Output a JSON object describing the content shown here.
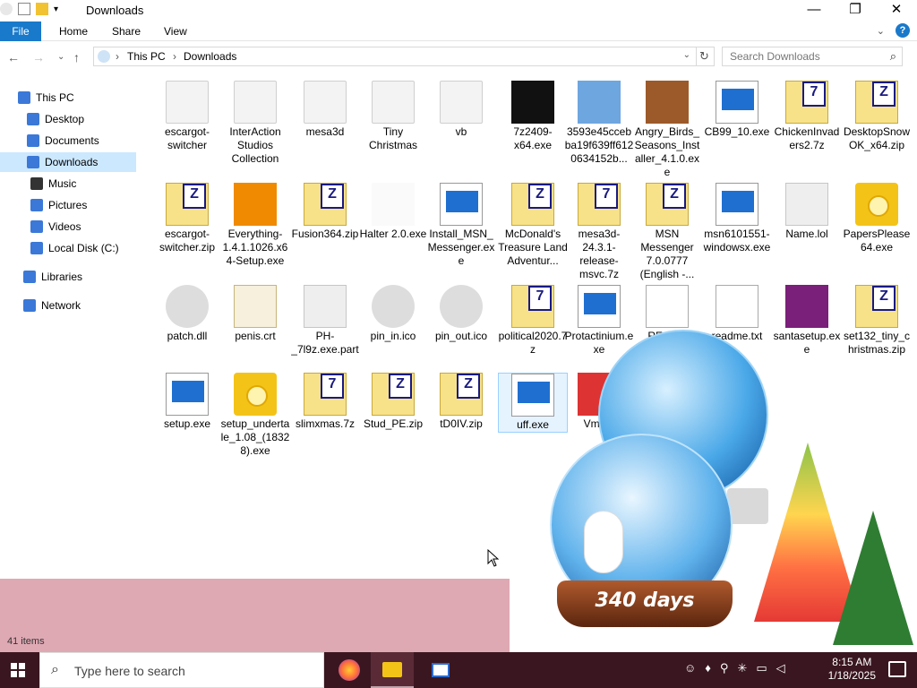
{
  "window": {
    "title": "Downloads",
    "controls": {
      "minimize": "—",
      "maximize": "❐",
      "close": "✕"
    }
  },
  "ribbon": {
    "tabs": [
      "File",
      "Home",
      "Share",
      "View"
    ]
  },
  "address": {
    "segments": [
      "This PC",
      "Downloads"
    ],
    "search_placeholder": "Search Downloads"
  },
  "sidebar": {
    "items": [
      {
        "label": "This PC",
        "icon": "pc-icon",
        "color": "#3b78d8"
      },
      {
        "label": "Desktop",
        "icon": "desktop-icon",
        "color": "#3b78d8"
      },
      {
        "label": "Documents",
        "icon": "documents-icon",
        "color": "#3b78d8"
      },
      {
        "label": "Downloads",
        "icon": "downloads-icon",
        "color": "#3b78d8"
      },
      {
        "label": "Music",
        "icon": "music-icon",
        "color": "#333333"
      },
      {
        "label": "Pictures",
        "icon": "pictures-icon",
        "color": "#3b78d8"
      },
      {
        "label": "Videos",
        "icon": "videos-icon",
        "color": "#3b78d8"
      },
      {
        "label": "Local Disk (C:)",
        "icon": "disk-icon",
        "color": "#3b78d8"
      },
      {
        "label": "Libraries",
        "icon": "libraries-icon",
        "color": "#3b78d8"
      },
      {
        "label": "Network",
        "icon": "network-icon",
        "color": "#3b78d8"
      }
    ]
  },
  "files": [
    {
      "label": "escargot-switcher",
      "icon": "folder-icon"
    },
    {
      "label": "InterAction Studios Collection",
      "icon": "folder-icon"
    },
    {
      "label": "mesa3d",
      "icon": "folder-icon"
    },
    {
      "label": "Tiny Christmas",
      "icon": "folder-icon"
    },
    {
      "label": "vb",
      "icon": "folder-icon"
    },
    {
      "label": "7z2409-x64.exe",
      "icon": "7zip-exe-icon"
    },
    {
      "label": "3593e45ccebba19f639ff6120634152b...",
      "icon": "script-icon"
    },
    {
      "label": "Angry_Birds_Seasons_Installer_4.1.0.exe",
      "icon": "angry-birds-icon"
    },
    {
      "label": "CB99_10.exe",
      "icon": "installer-icon"
    },
    {
      "label": "ChickenInvaders2.7z",
      "icon": "7z-archive-icon"
    },
    {
      "label": "DesktopSnowOK_x64.zip",
      "icon": "zip-archive-icon"
    },
    {
      "label": "escargot-switcher.zip",
      "icon": "zip-archive-icon"
    },
    {
      "label": "Everything-1.4.1.1026.x64-Setup.exe",
      "icon": "magnifier-icon"
    },
    {
      "label": "Fusion364.zip",
      "icon": "zip-archive-icon"
    },
    {
      "label": "Halter 2.0.exe",
      "icon": "halter-icon"
    },
    {
      "label": "Install_MSN_Messenger.exe",
      "icon": "installer-icon"
    },
    {
      "label": "McDonald's Treasure Land Adventur...",
      "icon": "zip-archive-icon"
    },
    {
      "label": "mesa3d-24.3.1-release-msvc.7z",
      "icon": "7z-archive-icon"
    },
    {
      "label": "MSN Messenger 7.0.0777 (English -...",
      "icon": "zip-archive-icon"
    },
    {
      "label": "msn6101551-windowsx.exe",
      "icon": "installer-icon"
    },
    {
      "label": "Name.lol",
      "icon": "binary-icon"
    },
    {
      "label": "PapersPlease64.exe",
      "icon": "disc-icon"
    },
    {
      "label": "patch.dll",
      "icon": "dll-icon"
    },
    {
      "label": "penis.crt",
      "icon": "certificate-icon"
    },
    {
      "label": "PH-_7l9z.exe.part",
      "icon": "binary-icon"
    },
    {
      "label": "pin_in.ico",
      "icon": "pin-icon"
    },
    {
      "label": "pin_out.ico",
      "icon": "pin-icon"
    },
    {
      "label": "political2020.7z",
      "icon": "7z-archive-icon"
    },
    {
      "label": "Protactinium.exe",
      "icon": "window-exe-icon"
    },
    {
      "label": "READ...",
      "icon": "text-icon"
    },
    {
      "label": "readme.txt",
      "icon": "text-icon"
    },
    {
      "label": "santasetup.exe",
      "icon": "santa-icon"
    },
    {
      "label": "set132_tiny_christmas.zip",
      "icon": "zip-archive-icon"
    },
    {
      "label": "setup.exe",
      "icon": "setup-icon"
    },
    {
      "label": "setup_undertale_1.08_(18328).exe",
      "icon": "disc-icon"
    },
    {
      "label": "slimxmas.7z",
      "icon": "7z-archive-icon"
    },
    {
      "label": "Stud_PE.zip",
      "icon": "zip-archive-icon"
    },
    {
      "label": "tD0IV.zip",
      "icon": "zip-archive-icon"
    },
    {
      "label": "uff.exe",
      "icon": "window-exe-icon"
    },
    {
      "label": "Vm0...",
      "icon": "app-icon"
    }
  ],
  "status": {
    "count": "41 items"
  },
  "overlay": {
    "counter_text": "340 days"
  },
  "taskbar": {
    "search_placeholder": "Type here to search",
    "time": "8:15 AM",
    "date": "1/18/2025"
  }
}
